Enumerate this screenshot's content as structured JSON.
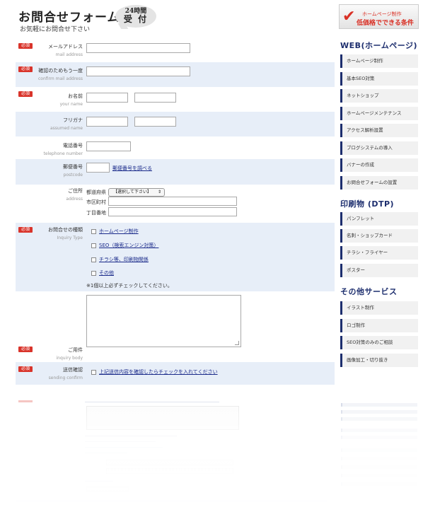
{
  "header": {
    "title": "お問合せフォーム",
    "subtitle": "お気軽にお問合せ下さい",
    "badge_line1": "24時間",
    "badge_line2": "受 付"
  },
  "form": {
    "required_label": "必須",
    "email": {
      "label_jp": "メールアドレス",
      "label_en": "mail address"
    },
    "confirm_email": {
      "label_jp": "確認のためもう一度",
      "label_en": "confirm mail address"
    },
    "name": {
      "label_jp": "お名前",
      "label_en": "your name"
    },
    "furigana": {
      "label_jp": "フリガナ",
      "label_en": "assumed name"
    },
    "phone": {
      "label_jp": "電話番号",
      "label_en": "telephone number"
    },
    "postal": {
      "label_jp": "郵便番号",
      "label_en": "postcode",
      "lookup_link": "郵便番号を調べる"
    },
    "address": {
      "label_jp": "ご住所",
      "label_en": "address",
      "prefecture_label": "都道府県",
      "prefecture_selected": "【選択して下さい】",
      "city_label": "市区町村",
      "street_label": "丁目番地"
    },
    "inquiry_type": {
      "label_jp": "お問合せの種類",
      "label_en": "Inquiry Type",
      "options": [
        "ホームページ制作",
        "SEO（検索エンジン対策）",
        "チラシ等、印刷物関係",
        "その他"
      ],
      "note": "※1個以上必ずチェックしてください。"
    },
    "body": {
      "label_jp": "ご用件",
      "label_en": "inquiry body"
    },
    "send_confirm": {
      "label_jp": "送信確認",
      "label_en": "sending confirm",
      "checkbox_text": "上記送信内容を確認したらチェックを入れてください"
    }
  },
  "sidebar": {
    "banner_line1": "ホームページ制作",
    "banner_line2": "低価格でできる条件",
    "sections": [
      {
        "title": "WEB(ホームページ)",
        "items": [
          "ホームページ制作",
          "基本SEO対策",
          "ネットショップ",
          "ホームページメンテナンス",
          "アクセス解析設置",
          "ブログシステムの導入",
          "バナーの作成",
          "お問合せフォームの設置"
        ]
      },
      {
        "title": "印刷物 (DTP)",
        "items": [
          "パンフレット",
          "名刺・ショップカード",
          "チラシ・フライヤー",
          "ポスター"
        ]
      },
      {
        "title": "その他サービス",
        "items": [
          "イラスト制作",
          "ロゴ制作",
          "SEO対策のみのご相談",
          "画像加工・切り抜き"
        ]
      }
    ]
  },
  "colors": {
    "accent_navy": "#1d2e6e",
    "required_red": "#d9342b",
    "row_shade": "#e7eef8",
    "link_blue": "#1a2a8a"
  }
}
